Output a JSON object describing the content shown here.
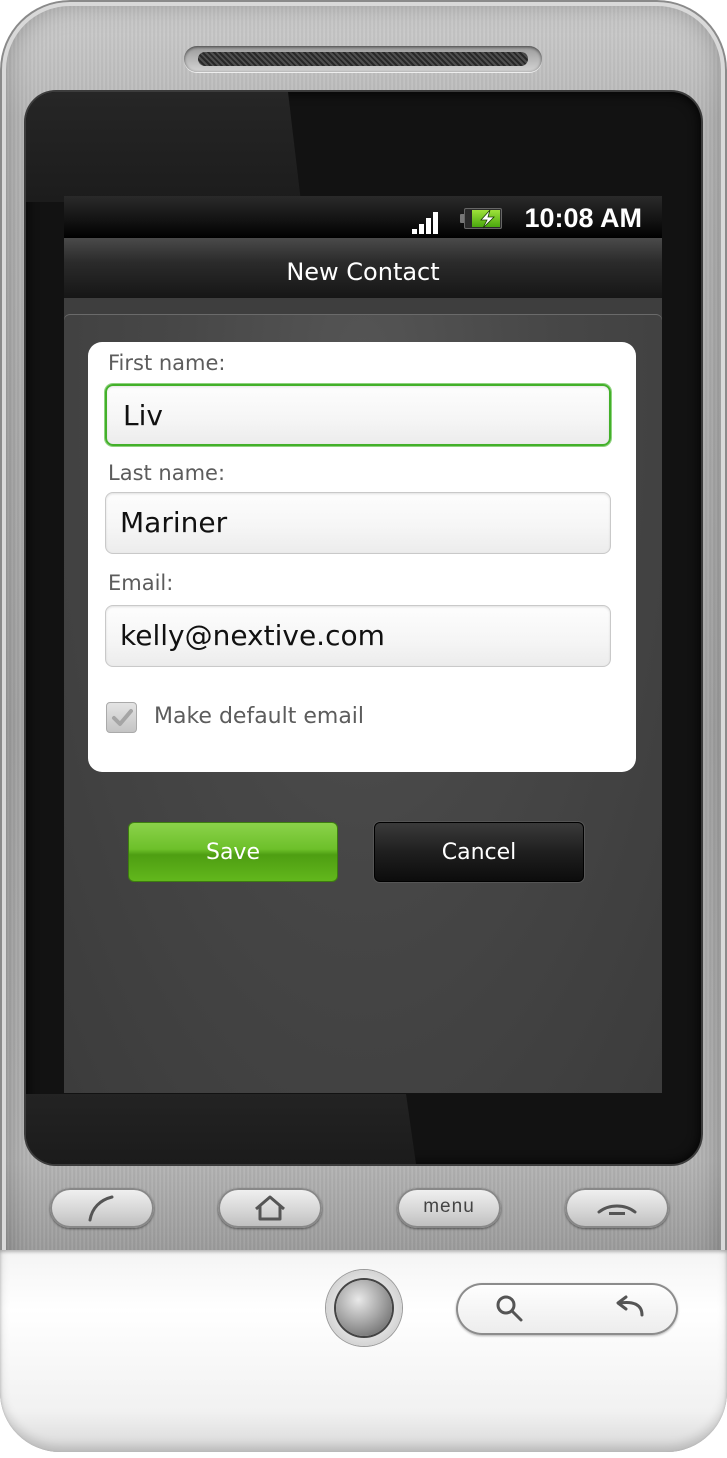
{
  "status_bar": {
    "time": "10:08 AM",
    "signal_icon": "signal-icon",
    "battery_icon": "battery-charging-icon"
  },
  "title_bar": {
    "title": "New Contact"
  },
  "form": {
    "first_name": {
      "label": "First name:",
      "value": "Liv"
    },
    "last_name": {
      "label": "Last name:",
      "value": "Mariner"
    },
    "email": {
      "label": "Email:",
      "value": "kelly@nextive.com"
    },
    "default_email": {
      "label": "Make default email",
      "checked": true
    }
  },
  "buttons": {
    "save": "Save",
    "cancel": "Cancel"
  },
  "hardware_keys": {
    "call_icon": "call-icon",
    "home_icon": "home-icon",
    "menu": "menu",
    "end_call_icon": "end-call-icon",
    "search_icon": "search-icon",
    "back_icon": "back-icon"
  },
  "colors": {
    "accent_green": "#43b02a",
    "save_green": "#6dc02a",
    "screen_bg": "#3e3e3e"
  }
}
